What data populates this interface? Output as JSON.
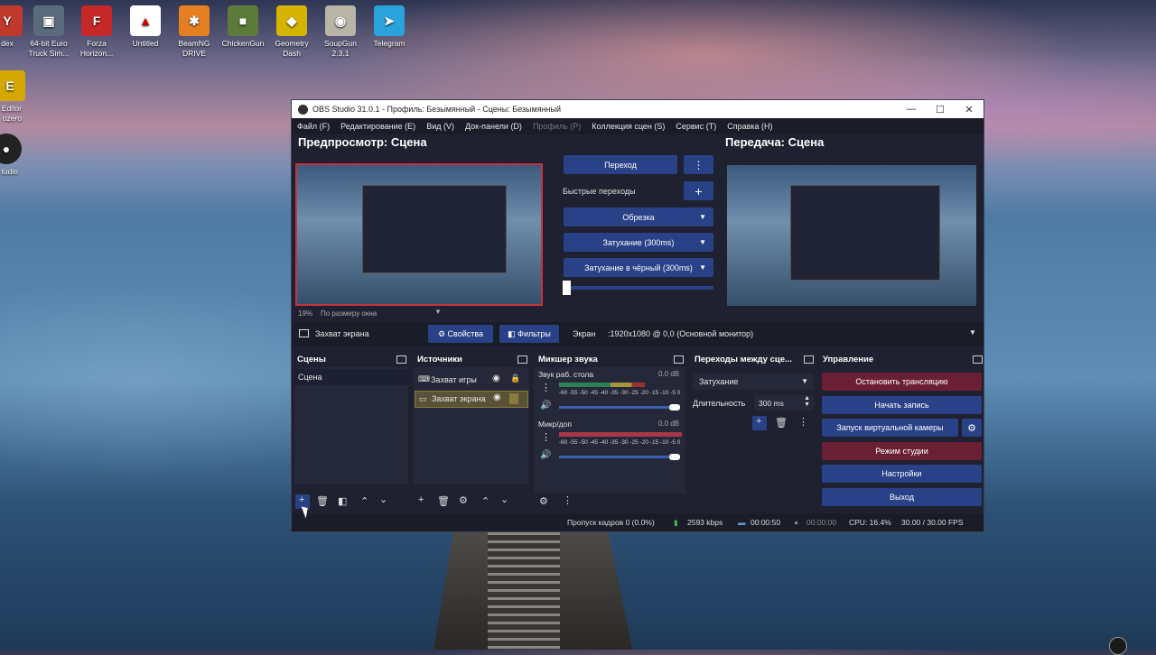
{
  "desktop": {
    "icons": [
      {
        "label": "dex",
        "color": "#c0392b"
      },
      {
        "label": "64-bit Euro Truck Sim...",
        "color": "#5a6b7c"
      },
      {
        "label": "Forza Horizon...",
        "color": "#c62828"
      },
      {
        "label": "Untitled",
        "color": "#ffffff"
      },
      {
        "label": "BeamNG DRIVE",
        "color": "#e67e22"
      },
      {
        "label": "ChickenGun",
        "color": "#5c7a3a"
      },
      {
        "label": "Geometry Dash",
        "color": "#d4b400"
      },
      {
        "label": "SoupGun 2.3.1",
        "color": "#b9b4a8"
      },
      {
        "label": "Telegram",
        "color": "#2aa3dd"
      }
    ],
    "left_icons": [
      {
        "label": "Editor ozero"
      },
      {
        "label": "tudio"
      }
    ]
  },
  "window": {
    "title": "OBS Studio 31.0.1 - Профиль: Безымянный - Сцены: Безымянный",
    "menu": [
      "Файл (F)",
      "Редактирование (E)",
      "Вид (V)",
      "Док-панели (D)",
      "Профиль (P)",
      "Коллекция сцен (S)",
      "Сервис (T)",
      "Справка (H)"
    ],
    "preview_title": "Предпросмотр: Сцена",
    "program_title": "Передача: Сцена",
    "zoom": "19%",
    "fit_label": "По размеру окна",
    "transition_button": "Переход",
    "quick_transitions": "Быстрые переходы",
    "quick_items": [
      "Обрезка",
      "Затухание (300ms)",
      "Затухание в чёрный (300ms)"
    ],
    "source_bar": {
      "source_name": "Захват экрана",
      "properties": "Свойства",
      "filters": "Фильтры",
      "screen_label": "Экран",
      "screen_value": ":1920x1080 @ 0,0 (Основной монитор)"
    }
  },
  "scenes": {
    "title": "Сцены",
    "items": [
      "Сцена"
    ]
  },
  "sources": {
    "title": "Источники",
    "items": [
      "Захват игры",
      "Захват экрана"
    ]
  },
  "mixer": {
    "title": "Микшер звука",
    "channels": [
      {
        "name": "Звук раб. стола",
        "db": "0.0 dB",
        "scale": "-60 -55 -50 -45 -40 -35 -30 -25 -20 -15 -10 -5 0",
        "level": 0.7
      },
      {
        "name": "Микр/доп",
        "db": "0.0 dB",
        "scale": "-60 -55 -50 -45 -40 -35 -30 -25 -20 -15 -10 -5 0",
        "level": 1.0
      }
    ]
  },
  "transitions": {
    "title": "Переходы между сце...",
    "selected": "Затухание",
    "duration_label": "Длительность",
    "duration_value": "300 ms"
  },
  "controls": {
    "title": "Управление",
    "buttons": [
      "Остановить трансляцию",
      "Начать запись",
      "Запуск виртуальной камеры",
      "Режим студии",
      "Настройки",
      "Выход"
    ]
  },
  "status": {
    "dropped": "Пропуск кадров 0 (0.0%)",
    "bitrate": "2593 kbps",
    "stream_time": "00:00:50",
    "rec_time": "00:00:00",
    "cpu": "CPU: 16.4%",
    "fps": "30.00 / 30.00 FPS"
  },
  "colors": {
    "accent": "#284187",
    "live": "#6b1f35"
  }
}
